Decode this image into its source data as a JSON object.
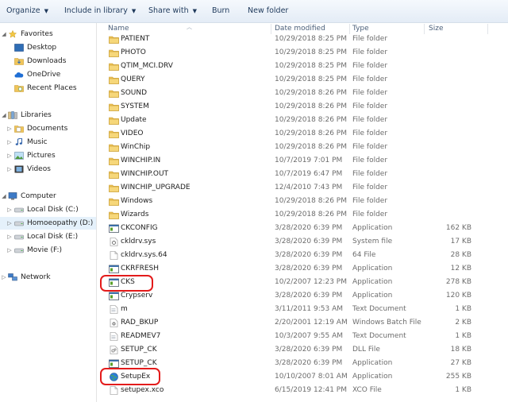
{
  "toolbar": {
    "organize": "Organize",
    "include_in_library": "Include in library",
    "share_with": "Share with",
    "burn": "Burn",
    "new_folder": "New folder"
  },
  "nav": {
    "favorites": "Favorites",
    "desktop": "Desktop",
    "downloads": "Downloads",
    "onedrive": "OneDrive",
    "recent_places": "Recent Places",
    "libraries": "Libraries",
    "documents": "Documents",
    "music": "Music",
    "pictures": "Pictures",
    "videos": "Videos",
    "computer": "Computer",
    "local_disk_c": "Local Disk (C:)",
    "homoeopathy_d": "Homoeopathy (D:)",
    "local_disk_e": "Local Disk (E:)",
    "movie_f": "Movie (F:)",
    "network": "Network"
  },
  "columns": {
    "name": "Name",
    "date_modified": "Date modified",
    "type": "Type",
    "size": "Size"
  },
  "files": [
    {
      "name": "PATIENT",
      "date": "10/29/2018 8:25 PM",
      "type": "File folder",
      "size": "",
      "icon": "folder-icon"
    },
    {
      "name": "PHOTO",
      "date": "10/29/2018 8:25 PM",
      "type": "File folder",
      "size": "",
      "icon": "folder-icon"
    },
    {
      "name": "QTIM_MCI.DRV",
      "date": "10/29/2018 8:25 PM",
      "type": "File folder",
      "size": "",
      "icon": "folder-icon"
    },
    {
      "name": "QUERY",
      "date": "10/29/2018 8:25 PM",
      "type": "File folder",
      "size": "",
      "icon": "folder-icon"
    },
    {
      "name": "SOUND",
      "date": "10/29/2018 8:26 PM",
      "type": "File folder",
      "size": "",
      "icon": "folder-icon"
    },
    {
      "name": "SYSTEM",
      "date": "10/29/2018 8:26 PM",
      "type": "File folder",
      "size": "",
      "icon": "folder-icon"
    },
    {
      "name": "Update",
      "date": "10/29/2018 8:26 PM",
      "type": "File folder",
      "size": "",
      "icon": "folder-icon"
    },
    {
      "name": "VIDEO",
      "date": "10/29/2018 8:26 PM",
      "type": "File folder",
      "size": "",
      "icon": "folder-icon"
    },
    {
      "name": "WinChip",
      "date": "10/29/2018 8:26 PM",
      "type": "File folder",
      "size": "",
      "icon": "folder-icon"
    },
    {
      "name": "WINCHIP.IN",
      "date": "10/7/2019 7:01 PM",
      "type": "File folder",
      "size": "",
      "icon": "folder-icon"
    },
    {
      "name": "WINCHIP.OUT",
      "date": "10/7/2019 6:47 PM",
      "type": "File folder",
      "size": "",
      "icon": "folder-icon"
    },
    {
      "name": "WINCHIP_UPGRADE",
      "date": "12/4/2010 7:43 PM",
      "type": "File folder",
      "size": "",
      "icon": "folder-icon"
    },
    {
      "name": "Windows",
      "date": "10/29/2018 8:26 PM",
      "type": "File folder",
      "size": "",
      "icon": "folder-icon"
    },
    {
      "name": "Wizards",
      "date": "10/29/2018 8:26 PM",
      "type": "File folder",
      "size": "",
      "icon": "folder-icon"
    },
    {
      "name": "CKCONFIG",
      "date": "3/28/2020 6:39 PM",
      "type": "Application",
      "size": "162 KB",
      "icon": "application-icon"
    },
    {
      "name": "ckldrv.sys",
      "date": "3/28/2020 6:39 PM",
      "type": "System file",
      "size": "17 KB",
      "icon": "system-file-icon"
    },
    {
      "name": "ckldrv.sys.64",
      "date": "3/28/2020 6:39 PM",
      "type": "64 File",
      "size": "28 KB",
      "icon": "file-icon"
    },
    {
      "name": "CKRFRESH",
      "date": "3/28/2020 6:39 PM",
      "type": "Application",
      "size": "12 KB",
      "icon": "application-icon"
    },
    {
      "name": "CKS",
      "date": "10/2/2007 12:23 PM",
      "type": "Application",
      "size": "278 KB",
      "icon": "application-icon"
    },
    {
      "name": "Crypserv",
      "date": "3/28/2020 6:39 PM",
      "type": "Application",
      "size": "120 KB",
      "icon": "application-icon"
    },
    {
      "name": "m",
      "date": "3/11/2011 9:53 AM",
      "type": "Text Document",
      "size": "1 KB",
      "icon": "text-document-icon"
    },
    {
      "name": "RAD_BKUP",
      "date": "2/20/2001 12:19 AM",
      "type": "Windows Batch File",
      "size": "2 KB",
      "icon": "batch-file-icon"
    },
    {
      "name": "READMEV7",
      "date": "10/3/2007 9:55 AM",
      "type": "Text Document",
      "size": "1 KB",
      "icon": "text-document-icon"
    },
    {
      "name": "SETUP_CK",
      "date": "3/28/2020 6:39 PM",
      "type": "DLL File",
      "size": "18 KB",
      "icon": "dll-file-icon"
    },
    {
      "name": "SETUP_CK",
      "date": "3/28/2020 6:39 PM",
      "type": "Application",
      "size": "27 KB",
      "icon": "application-icon"
    },
    {
      "name": "SetupEx",
      "date": "10/10/2007 8:01 AM",
      "type": "Application",
      "size": "255 KB",
      "icon": "setup-globe-icon"
    },
    {
      "name": "setupex.xco",
      "date": "6/15/2019 12:41 PM",
      "type": "XCO File",
      "size": "1 KB",
      "icon": "file-icon"
    }
  ],
  "colors": {
    "annotation": "#e31b1b",
    "folder": "#f0c55a",
    "selection": "#e5f1fb"
  }
}
